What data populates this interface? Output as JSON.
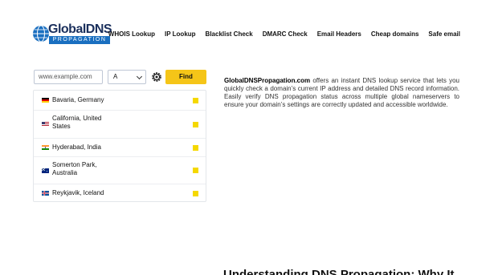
{
  "logo": {
    "main": "GlobalDNS",
    "sub": "PROPAGATION"
  },
  "nav": [
    "WHOIS Lookup",
    "IP Lookup",
    "Blacklist Check",
    "DMARC Check",
    "Email Headers",
    "Cheap domains",
    "Safe email"
  ],
  "search": {
    "placeholder": "www.example.com",
    "record_type": "A",
    "find_label": "Find"
  },
  "results": [
    {
      "location": "Bavaria, Germany",
      "flag": "de"
    },
    {
      "location": "California, United States",
      "flag": "us"
    },
    {
      "location": "Hyderabad, India",
      "flag": "in"
    },
    {
      "location": "Somerton Park, Australia",
      "flag": "au"
    },
    {
      "location": "Reykjavik, Iceland",
      "flag": "is"
    }
  ],
  "description": {
    "brand": "GlobalDNSPropagation.com",
    "text": " offers an instant DNS lookup service that lets you quickly check a domain’s current IP address and detailed DNS record information. Easily verify DNS propagation status across multiple global nameservers to ensure your domain’s settings are correctly updated and accessible worldwide."
  },
  "heading": "Understanding DNS Propagation: Why It",
  "colors": {
    "accent": "#f5c518",
    "brand_navy": "#1a2f5c",
    "brand_blue": "#1a6fc0",
    "status": "#f5d800"
  }
}
